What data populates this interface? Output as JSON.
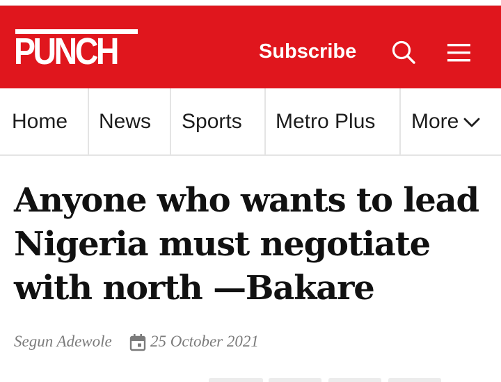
{
  "header": {
    "logo_text": "PUNCH",
    "subscribe_label": "Subscribe",
    "search_icon": "search-icon",
    "menu_icon": "hamburger-menu-icon",
    "brand_color": "#e0161d"
  },
  "nav": {
    "items": [
      {
        "label": "Home"
      },
      {
        "label": "News"
      },
      {
        "label": "Sports"
      },
      {
        "label": "Metro Plus"
      },
      {
        "label": "More"
      }
    ],
    "more_icon": "chevron-down-icon"
  },
  "article": {
    "headline": "Anyone who wants to lead Nigeria must negotiate with north —Bakare",
    "author": "Segun Adewole",
    "date": "25 October 2021",
    "date_icon": "calendar-icon"
  }
}
